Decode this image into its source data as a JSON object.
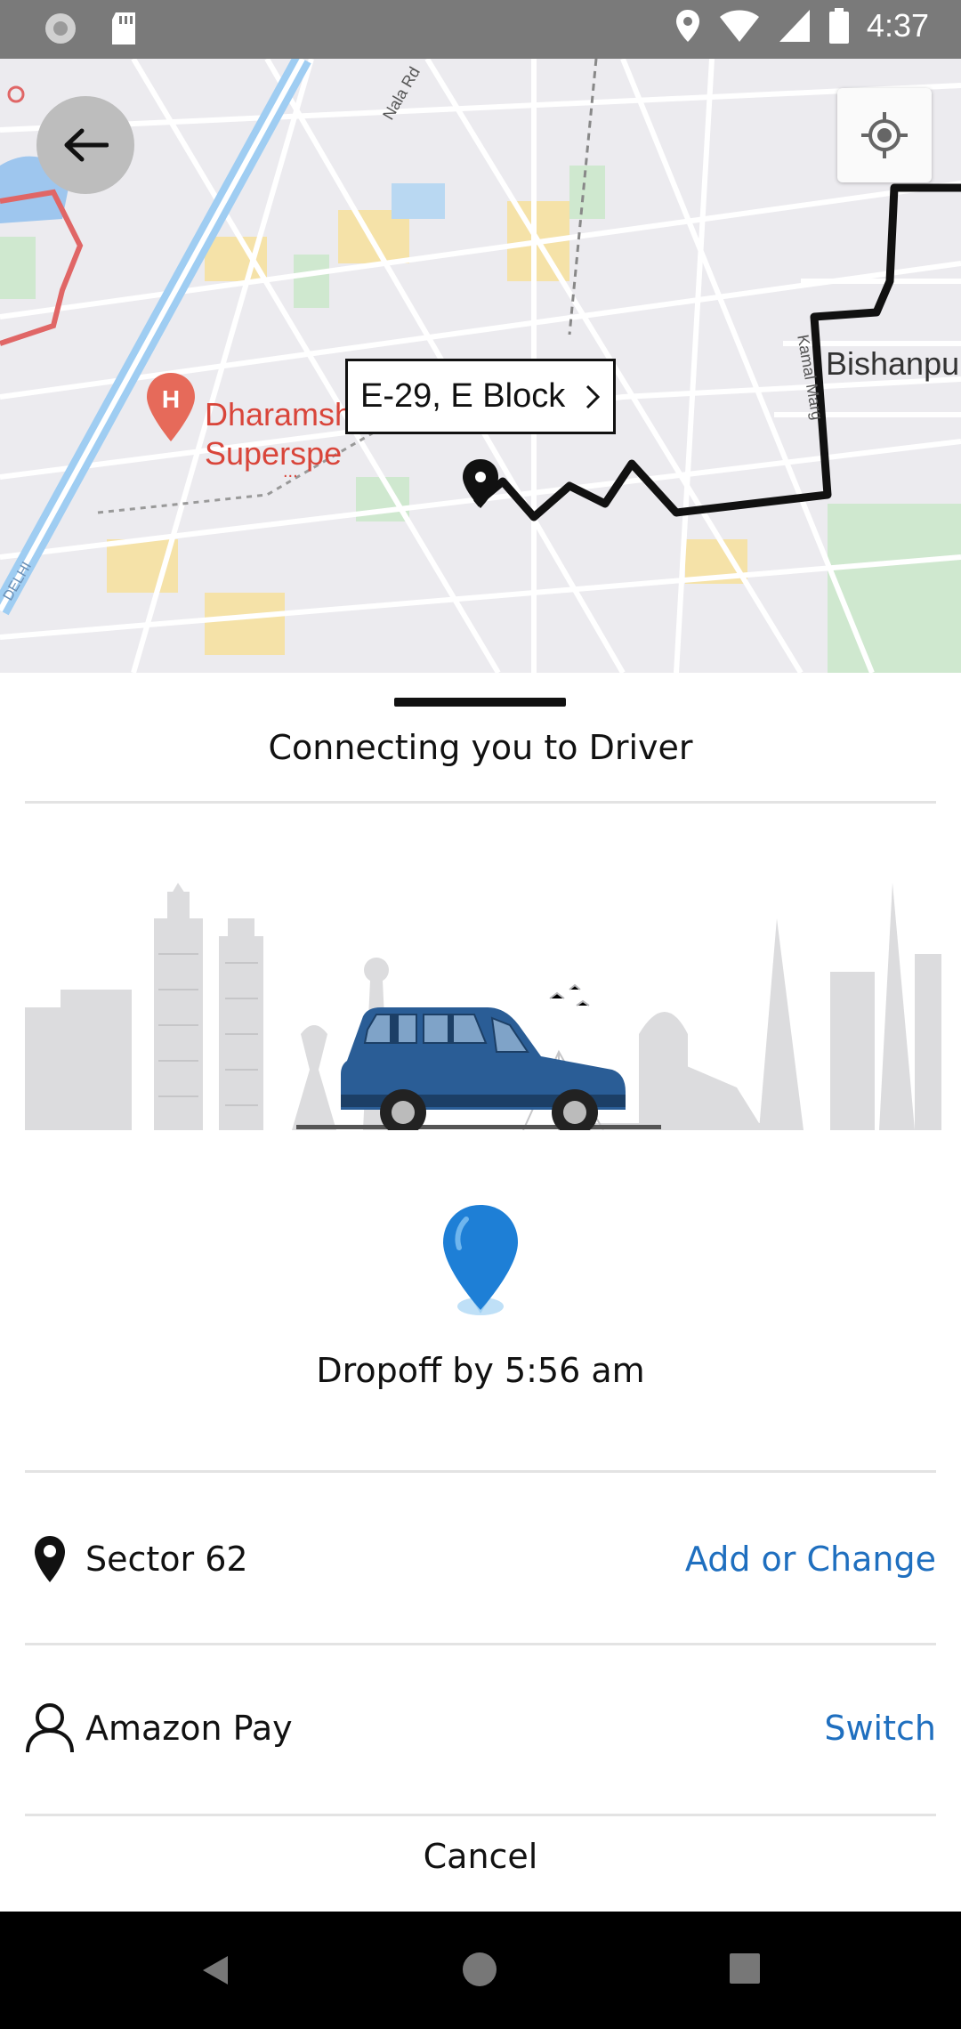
{
  "status_bar": {
    "time": "4:37",
    "icons": [
      "activity-icon",
      "sd-card-icon",
      "location-icon",
      "wifi-icon",
      "signal-icon",
      "battery-icon"
    ]
  },
  "map": {
    "poi_name_line1": "Dharamshila Narayana",
    "poi_name_line2": "Superspe",
    "poi_ellipsis": "...",
    "area_label": "Bishanpu",
    "road_label_1": "Nala Rd",
    "road_label_2": "Kamal Marg",
    "road_label_3": "DELHI",
    "pickup_label": "E-29, E Block",
    "poi_icon_letter": "H"
  },
  "sheet": {
    "title": "Connecting you to Driver",
    "dropoff_text": "Dropoff by 5:56 am",
    "destination": {
      "label": "Sector 62",
      "action": "Add or Change"
    },
    "payment": {
      "label": "Amazon Pay",
      "action": "Switch"
    },
    "cancel_label": "Cancel"
  },
  "colors": {
    "accent": "#1f6fbf",
    "status_bar": "#7a7a7a",
    "route": "#111111",
    "car": "#2a5d96"
  }
}
